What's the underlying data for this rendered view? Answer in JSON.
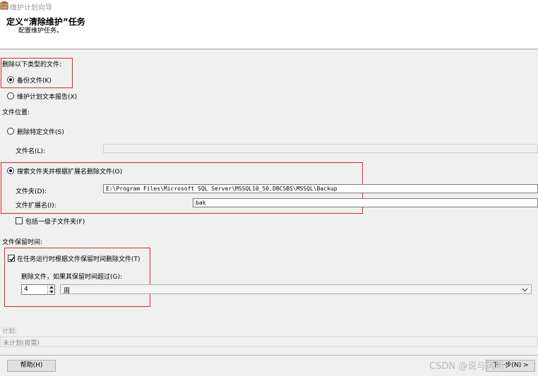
{
  "window": {
    "title": "维护计划向导"
  },
  "header": {
    "title": "定义“清除维护”任务",
    "subtitle": "配置维护任务。"
  },
  "delete_type": {
    "label": "删除以下类型的文件:",
    "options": [
      {
        "label": "备份文件(K)",
        "selected": true
      },
      {
        "label": "维护计划文本报告(X)",
        "selected": false
      }
    ]
  },
  "file_location": {
    "label": "文件位置:",
    "specific_file": {
      "label": "删除特定文件(S)",
      "selected": false
    },
    "file_name_label": "文件名(L):",
    "file_name_value": "",
    "search_folder": {
      "label": "搜索文件夹并根据扩展名删除文件(O)",
      "selected": true
    },
    "folder_label": "文件夹(D):",
    "folder_value": "E:\\Program Files\\Microsoft SQL Server\\MSSQL10_50.DBCSBS\\MSSQL\\Backup",
    "extension_label": "文件扩展名(I):",
    "extension_value": "bak",
    "include_subfolders": {
      "label": "包括一级子文件夹(F)",
      "checked": false
    }
  },
  "retention": {
    "label": "文件保留时间:",
    "delete_on_age": {
      "label": "在任务运行时根据文件保留时间删除文件(T)",
      "checked": true
    },
    "age_label": "删除文件，如果其保留时间超过(G):",
    "age_value": "4",
    "unit_value": "周"
  },
  "schedule": {
    "label": "计划:",
    "value": "未计划(按需)"
  },
  "buttons": {
    "help": "帮助(H)",
    "next": "下一步(N) >"
  },
  "watermark": "CSDN @说与风听"
}
